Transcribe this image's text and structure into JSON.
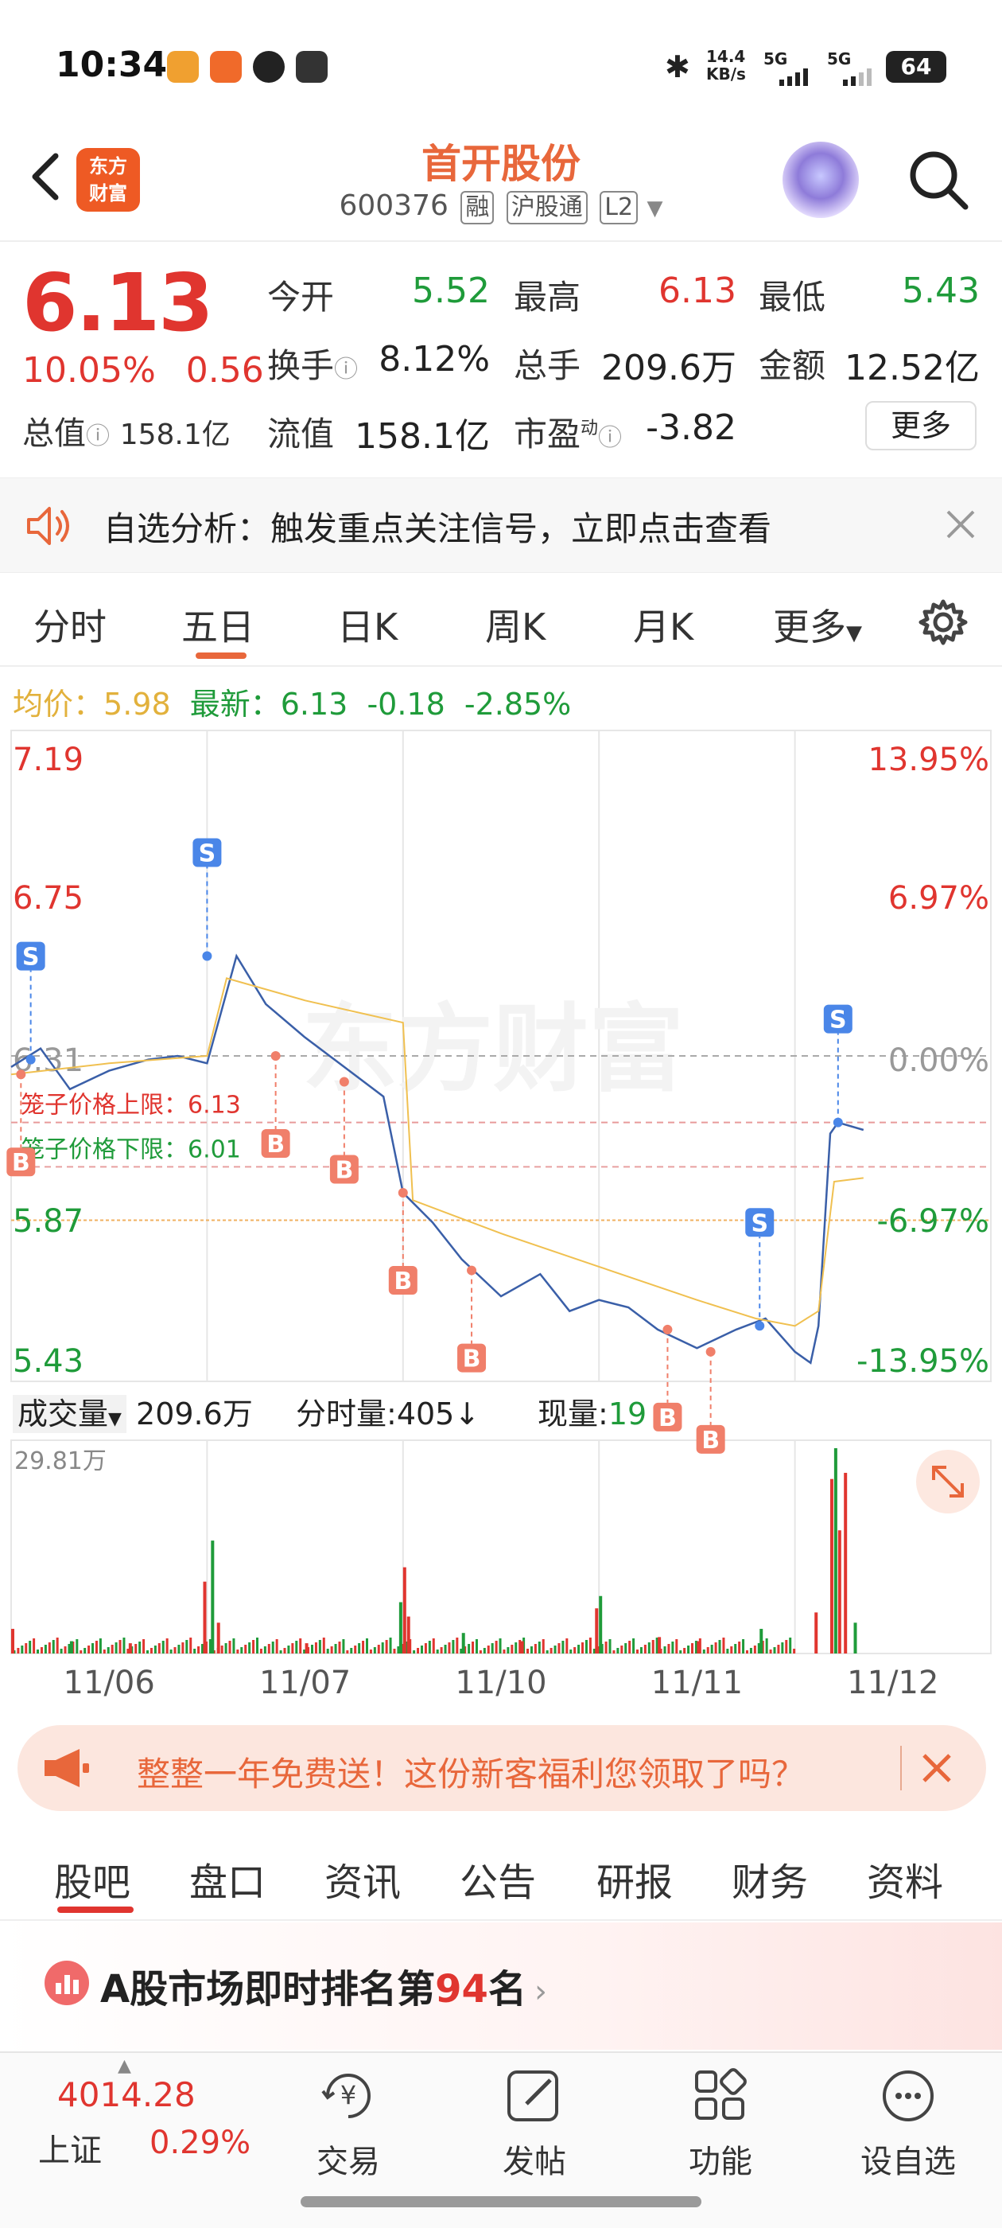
{
  "status_bar": {
    "time": "10:34",
    "net_speed_value": "14.4",
    "net_speed_unit": "KB/s",
    "signal_1": "5G",
    "signal_2": "5G",
    "battery": "64"
  },
  "header": {
    "logo_text_line1": "东方",
    "logo_text_line2": "财富",
    "stock_name": "首开股份",
    "stock_code": "600376",
    "tag_margin": "融",
    "tag_connect": "沪股通",
    "tag_level": "L2"
  },
  "quote": {
    "price": "6.13",
    "change_pct": "10.05%",
    "change_amt": "0.56",
    "total_value_label": "总值",
    "total_value": "158.1亿",
    "open_label": "今开",
    "open": "5.52",
    "high_label": "最高",
    "high": "6.13",
    "low_label": "最低",
    "low": "5.43",
    "turnover_label": "换手",
    "turnover": "8.12%",
    "volume_label": "总手",
    "volume": "209.6万",
    "amount_label": "金额",
    "amount": "12.52亿",
    "float_label": "流值",
    "float_value": "158.1亿",
    "pe_label": "市盈",
    "pe_superscript": "动",
    "pe": "-3.82",
    "more_button": "更多"
  },
  "banner": {
    "text": "自选分析：触发重点关注信号，立即点击查看"
  },
  "chart_tabs": [
    "分时",
    "五日",
    "日K",
    "周K",
    "月K",
    "更多"
  ],
  "chart_tabs_active": "五日",
  "chart_info": {
    "avg_label": "均价：",
    "avg_value": "5.98",
    "latest_label": "最新：",
    "latest_value": "6.13",
    "latest_change": "-0.18",
    "latest_pct": "-2.85%"
  },
  "chart_data": {
    "type": "line",
    "title": "",
    "x_categories": [
      "11/06",
      "11/07",
      "11/10",
      "11/11",
      "11/12"
    ],
    "y_left_ticks": [
      "7.19",
      "6.75",
      "6.31",
      "5.87",
      "5.43"
    ],
    "y_right_ticks": [
      "13.95%",
      "6.97%",
      "0.00%",
      "-6.97%",
      "-13.95%"
    ],
    "ylim": [
      5.43,
      7.19
    ],
    "reference_close": 6.31,
    "price_limit_upper_label": "笼子价格上限：6.13",
    "price_limit_upper": 6.13,
    "price_limit_lower_label": "笼子价格下限：6.01",
    "price_limit_lower": 6.01,
    "series": [
      {
        "name": "price",
        "color": "#3a5fa8",
        "x": [
          0,
          0.15,
          0.3,
          0.5,
          0.7,
          0.85,
          1.0,
          1.15,
          1.3,
          1.5,
          1.7,
          1.9,
          2.0,
          2.15,
          2.3,
          2.5,
          2.7,
          2.85,
          3.0,
          3.15,
          3.3,
          3.5,
          3.7,
          3.85,
          4.0,
          4.08,
          4.12,
          4.18,
          4.22,
          4.35
        ],
        "y": [
          6.28,
          6.33,
          6.22,
          6.27,
          6.3,
          6.31,
          6.29,
          6.58,
          6.45,
          6.36,
          6.28,
          6.2,
          5.94,
          5.86,
          5.76,
          5.66,
          5.72,
          5.62,
          5.65,
          5.63,
          5.57,
          5.52,
          5.57,
          5.6,
          5.51,
          5.48,
          5.58,
          6.1,
          6.13,
          6.11
        ]
      },
      {
        "name": "avg",
        "color": "#f0c050",
        "x": [
          0,
          0.5,
          1.0,
          1.1,
          1.5,
          2.0,
          2.05,
          2.5,
          3.0,
          3.5,
          3.8,
          4.0,
          4.12,
          4.2,
          4.35
        ],
        "y": [
          6.26,
          6.29,
          6.31,
          6.52,
          6.46,
          6.4,
          5.92,
          5.83,
          5.74,
          5.65,
          5.6,
          5.58,
          5.62,
          5.97,
          5.98
        ]
      }
    ],
    "markers": [
      {
        "label": "S",
        "x": 0.1,
        "y": 6.3,
        "color": "#4a86e8"
      },
      {
        "label": "B",
        "x": 0.05,
        "y": 6.26,
        "color": "#f07f6a"
      },
      {
        "label": "S",
        "x": 1.0,
        "y": 6.58,
        "color": "#4a86e8"
      },
      {
        "label": "B",
        "x": 1.35,
        "y": 6.31,
        "color": "#f07f6a"
      },
      {
        "label": "B",
        "x": 1.7,
        "y": 6.24,
        "color": "#f07f6a"
      },
      {
        "label": "B",
        "x": 2.0,
        "y": 5.94,
        "color": "#f07f6a"
      },
      {
        "label": "B",
        "x": 2.35,
        "y": 5.73,
        "color": "#f07f6a"
      },
      {
        "label": "B",
        "x": 3.35,
        "y": 5.57,
        "color": "#f07f6a"
      },
      {
        "label": "B",
        "x": 3.57,
        "y": 5.51,
        "color": "#f07f6a"
      },
      {
        "label": "S",
        "x": 3.82,
        "y": 5.58,
        "color": "#4a86e8"
      },
      {
        "label": "S",
        "x": 4.22,
        "y": 6.13,
        "color": "#4a86e8"
      }
    ],
    "grid": true,
    "watermark": "东方财富"
  },
  "volume": {
    "selector": "成交量",
    "total": "209.6万",
    "tick_label": "分时量:",
    "tick_value": "405",
    "current_label": "现量:",
    "current_value": "19",
    "max_label": "29.81万",
    "bars": [
      {
        "x": 0.0,
        "v": 0.12
      },
      {
        "x": 0.3,
        "v": 0.06
      },
      {
        "x": 0.6,
        "v": 0.05
      },
      {
        "x": 0.98,
        "v": 0.35
      },
      {
        "x": 1.02,
        "v": 0.55
      },
      {
        "x": 1.05,
        "v": 0.15
      },
      {
        "x": 1.5,
        "v": 0.05
      },
      {
        "x": 1.98,
        "v": 0.25
      },
      {
        "x": 2.0,
        "v": 0.42
      },
      {
        "x": 2.02,
        "v": 0.18
      },
      {
        "x": 2.3,
        "v": 0.1
      },
      {
        "x": 2.6,
        "v": 0.06
      },
      {
        "x": 2.98,
        "v": 0.22
      },
      {
        "x": 3.0,
        "v": 0.28
      },
      {
        "x": 3.3,
        "v": 0.08
      },
      {
        "x": 3.5,
        "v": 0.06
      },
      {
        "x": 3.82,
        "v": 0.12
      },
      {
        "x": 4.1,
        "v": 0.2
      },
      {
        "x": 4.18,
        "v": 0.85
      },
      {
        "x": 4.2,
        "v": 1.0
      },
      {
        "x": 4.22,
        "v": 0.6
      },
      {
        "x": 4.25,
        "v": 0.88
      },
      {
        "x": 4.3,
        "v": 0.15
      }
    ]
  },
  "ad": {
    "text": "整整一年免费送！这份新客福利您领取了吗？"
  },
  "bottom_tabs": [
    "股吧",
    "盘口",
    "资讯",
    "公告",
    "研报",
    "财务",
    "资料"
  ],
  "bottom_tabs_active": "股吧",
  "ranking": {
    "prefix": "A股市场即时排名第",
    "rank": "94",
    "suffix": "名"
  },
  "bottom_nav": {
    "index_value": "4014.28",
    "index_name": "上证",
    "index_pct": "0.29%",
    "items": [
      "交易",
      "发帖",
      "功能",
      "设自选"
    ]
  }
}
